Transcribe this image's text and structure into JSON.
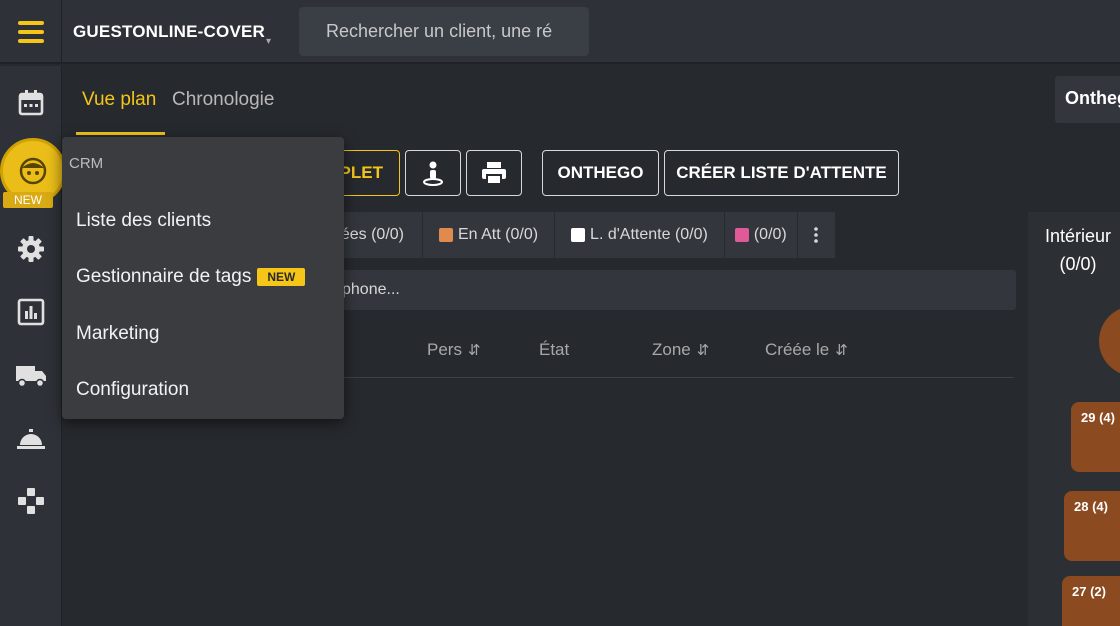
{
  "header": {
    "venue_name": "GUESTONLINE-COVER",
    "venue_caret": "▾",
    "search_placeholder": "Rechercher un client, une ré"
  },
  "sidebar": {
    "items": [
      {
        "icon": "calendar-icon"
      },
      {
        "icon": "crm-face-icon",
        "badge": "NEW"
      },
      {
        "icon": "gear-icon"
      },
      {
        "icon": "report-chart-icon"
      },
      {
        "icon": "delivery-truck-icon"
      },
      {
        "icon": "service-bell-icon"
      },
      {
        "icon": "puzzle-icon"
      }
    ]
  },
  "tabs": [
    {
      "label": "Vue plan",
      "active": true
    },
    {
      "label": "Chronologie",
      "active": false
    }
  ],
  "actions": {
    "complet_label": "PLET",
    "onthego_label": "ONTHEGO",
    "waitlist_label": "CRÉER LISTE D'ATTENTE"
  },
  "filters": [
    {
      "label": "ées (0/0)",
      "color": ""
    },
    {
      "label": "En Att (0/0)",
      "color": "#e08a4e"
    },
    {
      "label": "L. d'Attente (0/0)",
      "color": "#ffffff"
    },
    {
      "label": "(0/0)",
      "color": "#e05a9a"
    }
  ],
  "customer_search_placeholder": "phone...",
  "table_headers": {
    "pers": "Pers",
    "etat": "État",
    "zone": "Zone",
    "created": "Créée le",
    "sort_glyph": "⇵"
  },
  "right_panel": {
    "onthego_label": "Onthego",
    "zone_name": "Intérieur",
    "zone_count": "(0/0)",
    "tables": [
      "29 (4)",
      "28 (4)",
      "27 (2)"
    ]
  },
  "crm_menu": {
    "header": "CRM",
    "items": [
      {
        "label": "Liste des clients",
        "badge": ""
      },
      {
        "label": "Gestionnaire de tags",
        "badge": "NEW"
      },
      {
        "label": "Marketing",
        "badge": ""
      },
      {
        "label": "Configuration",
        "badge": ""
      }
    ]
  },
  "colors": {
    "accent": "#f5c518",
    "table_brown": "#8b4a1f"
  }
}
